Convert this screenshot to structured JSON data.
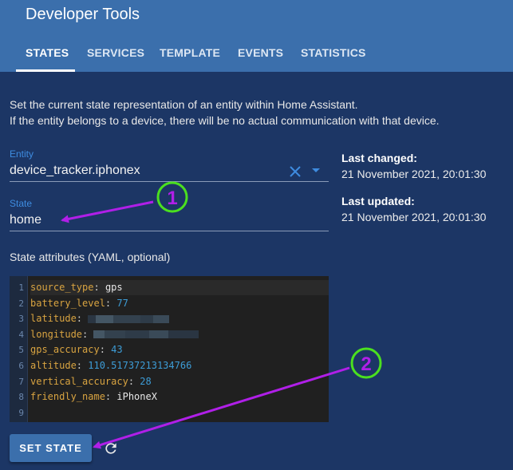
{
  "app": {
    "title": "Developer Tools"
  },
  "tabs": [
    {
      "label": "STATES",
      "active": true
    },
    {
      "label": "SERVICES",
      "active": false
    },
    {
      "label": "TEMPLATE",
      "active": false
    },
    {
      "label": "EVENTS",
      "active": false
    },
    {
      "label": "STATISTICS",
      "active": false
    }
  ],
  "description": {
    "line1": "Set the current state representation of an entity within Home Assistant.",
    "line2": "If the entity belongs to a device, there will be no actual communication with that device."
  },
  "entity": {
    "label": "Entity",
    "value": "device_tracker.iphonex"
  },
  "state": {
    "label": "State",
    "value": "home"
  },
  "info": {
    "last_changed_label": "Last changed:",
    "last_changed_value": "21 November 2021, 20:01:30",
    "last_updated_label": "Last updated:",
    "last_updated_value": "21 November 2021, 20:01:30"
  },
  "attributes": {
    "label": "State attributes (YAML, optional)",
    "line_numbers": [
      "1",
      "2",
      "3",
      "4",
      "5",
      "6",
      "7",
      "8",
      "9"
    ],
    "lines": [
      {
        "key": "source_type",
        "value": "gps",
        "kind": "s"
      },
      {
        "key": "battery_level",
        "value": "77",
        "kind": "n"
      },
      {
        "key": "latitude",
        "value": "",
        "kind": "blur"
      },
      {
        "key": "longitude",
        "value": "",
        "kind": "blur"
      },
      {
        "key": "gps_accuracy",
        "value": "43",
        "kind": "n"
      },
      {
        "key": "altitude",
        "value": "110.51737213134766",
        "kind": "n"
      },
      {
        "key": "vertical_accuracy",
        "value": "28",
        "kind": "n"
      },
      {
        "key": "friendly_name",
        "value": "iPhoneX",
        "kind": "s"
      }
    ]
  },
  "actions": {
    "set_state_label": "SET STATE"
  },
  "annotations": {
    "marker1": "1",
    "marker2": "2"
  },
  "colors": {
    "header": "#3b6fac",
    "background": "#1c3665",
    "accent": "#3e8ce0",
    "annotation_circle": "#4be01f",
    "annotation_arrow": "#b01fe8"
  }
}
